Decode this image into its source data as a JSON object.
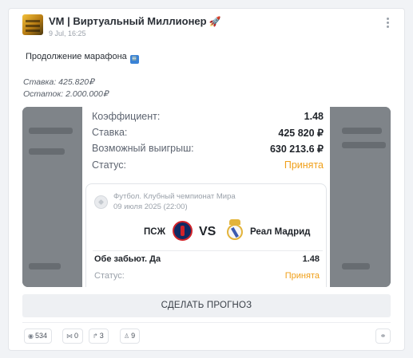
{
  "post": {
    "channel_name": "VM | Виртуальный Миллионер",
    "channel_emoji": "🚀",
    "date": "9 Jul, 16:25",
    "intro_text": "Продолжение марафона",
    "intro_badge": "🆕",
    "stake_line": "Ставка: 425.820₽",
    "balance_line": "Остаток: 2.000.000₽"
  },
  "bet_slip": {
    "rows": [
      {
        "label": "Коэффициент:",
        "value": "1.48"
      },
      {
        "label": "Ставка:",
        "value": "425 820 ₽"
      },
      {
        "label": "Возможный выигрыш:",
        "value": "630 213.6 ₽"
      },
      {
        "label": "Статус:",
        "value": "Принята"
      }
    ],
    "match": {
      "league": "Футбол. Клубный чемпионат Мира",
      "date": "09 июля 2025 (22:00)",
      "home_team": "ПСЖ",
      "vs": "VS",
      "away_team": "Реал Мадрид",
      "market": "Обе забьют. Да",
      "odds": "1.48",
      "status_label": "Статус:",
      "status_value": "Принята"
    }
  },
  "actions": {
    "forecast_button": "СДЕЛАТЬ ПРОГНОЗ",
    "views": "534",
    "comments": "0",
    "shares": "3",
    "likes": "9"
  },
  "colors": {
    "accepted": "#f0a01a",
    "button_bg": "#eef0f3"
  },
  "icons": [
    "menu-icon",
    "football-icon",
    "eye-icon",
    "comment-icon",
    "share-icon",
    "like-icon",
    "link-icon"
  ]
}
